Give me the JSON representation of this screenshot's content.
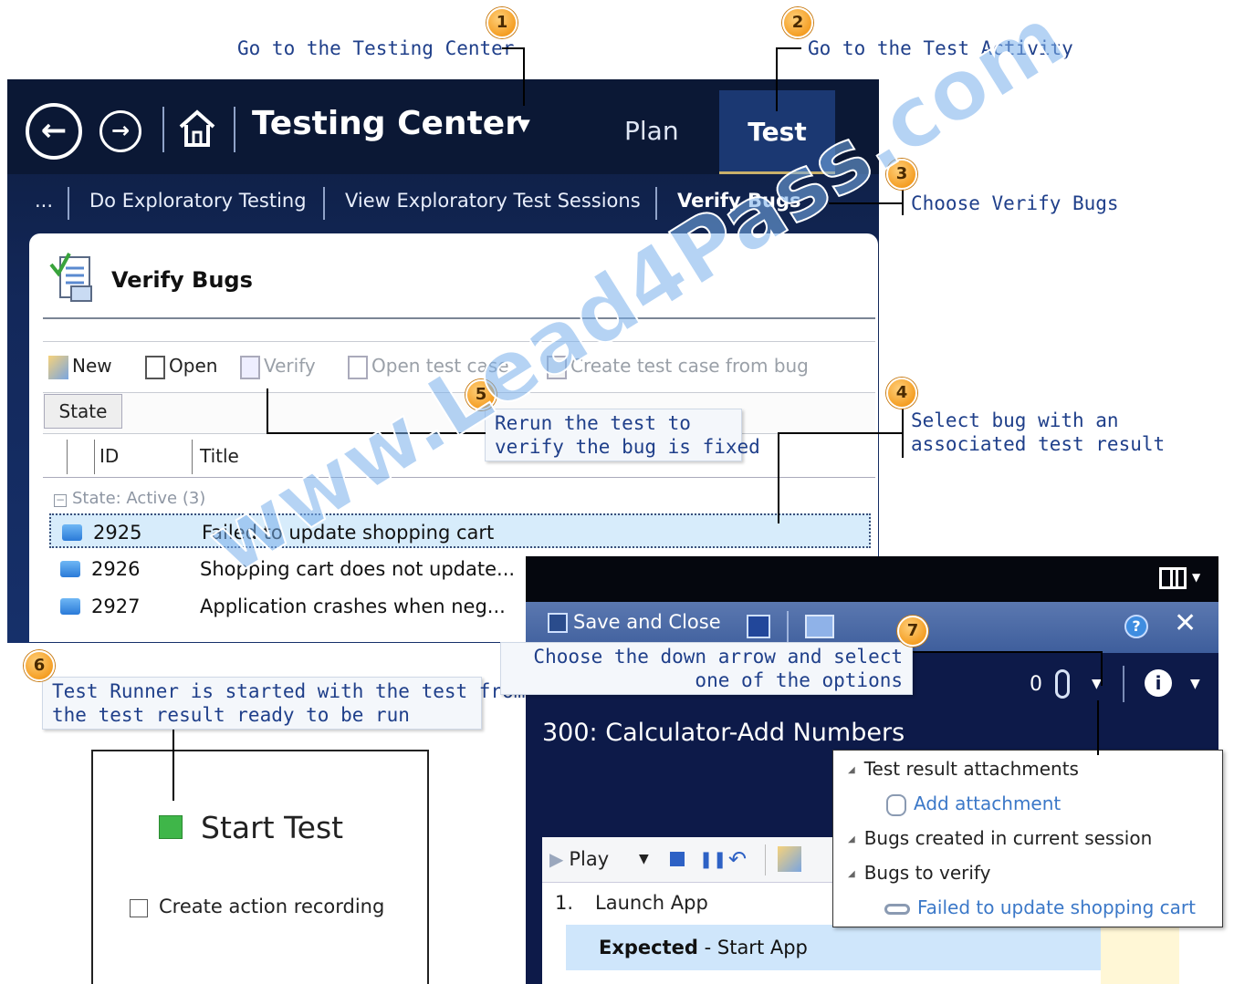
{
  "callouts": {
    "c1": {
      "num": "1",
      "text": "Go to the Testing Center"
    },
    "c2": {
      "num": "2",
      "text": "Go to the Test Activity"
    },
    "c3": {
      "num": "3",
      "text": "Choose Verify Bugs"
    },
    "c4": {
      "num": "4",
      "line1": "Select bug with an",
      "line2": "associated test result"
    },
    "c5": {
      "num": "5",
      "line1": "Rerun the test to",
      "line2": "verify the bug is fixed"
    },
    "c6": {
      "num": "6",
      "line1": "Test Runner is started with the test from",
      "line2": "the test result ready to be run"
    },
    "c7": {
      "num": "7",
      "line1": "Choose the down arrow and select",
      "line2": "one of the options"
    }
  },
  "testing_center": {
    "title": "Testing Center",
    "tabs": {
      "plan": "Plan",
      "test": "Test"
    },
    "subnav": {
      "more": "...",
      "item1": "Do Exploratory Testing",
      "item2": "View Exploratory Test Sessions",
      "item3": "Verify Bugs"
    }
  },
  "verify_bugs": {
    "title": "Verify Bugs",
    "toolbar": {
      "new": "New",
      "open": "Open",
      "verify": "Verify",
      "open_test_case": "Open test case",
      "create_test_case": "Create test case from bug"
    },
    "group_chip": "State",
    "columns": {
      "id": "ID",
      "title": "Title"
    },
    "group_label": "State: Active (3)",
    "rows": [
      {
        "id": "2925",
        "title": "Failed to update shopping cart"
      },
      {
        "id": "2926",
        "title": "Shopping cart does not update..."
      },
      {
        "id": "2927",
        "title": "Application crashes when neg..."
      }
    ]
  },
  "test_runner": {
    "save_close": "Save and Close",
    "attachment_count": "0",
    "test_title": "300: Calculator-Add Numbers",
    "play": "Play",
    "step_num": "1.",
    "step_text": "Launch App",
    "expected_label": "Expected",
    "expected_text": "- Start App"
  },
  "popup": {
    "h1": "Test result attachments",
    "link1": "Add attachment",
    "h2": "Bugs created in current session",
    "h3": "Bugs to verify",
    "link2": "Failed to update shopping cart"
  },
  "start_test": {
    "label": "Start Test",
    "checkbox_label": "Create action recording"
  },
  "watermark": "www.Lead4Pass.com"
}
